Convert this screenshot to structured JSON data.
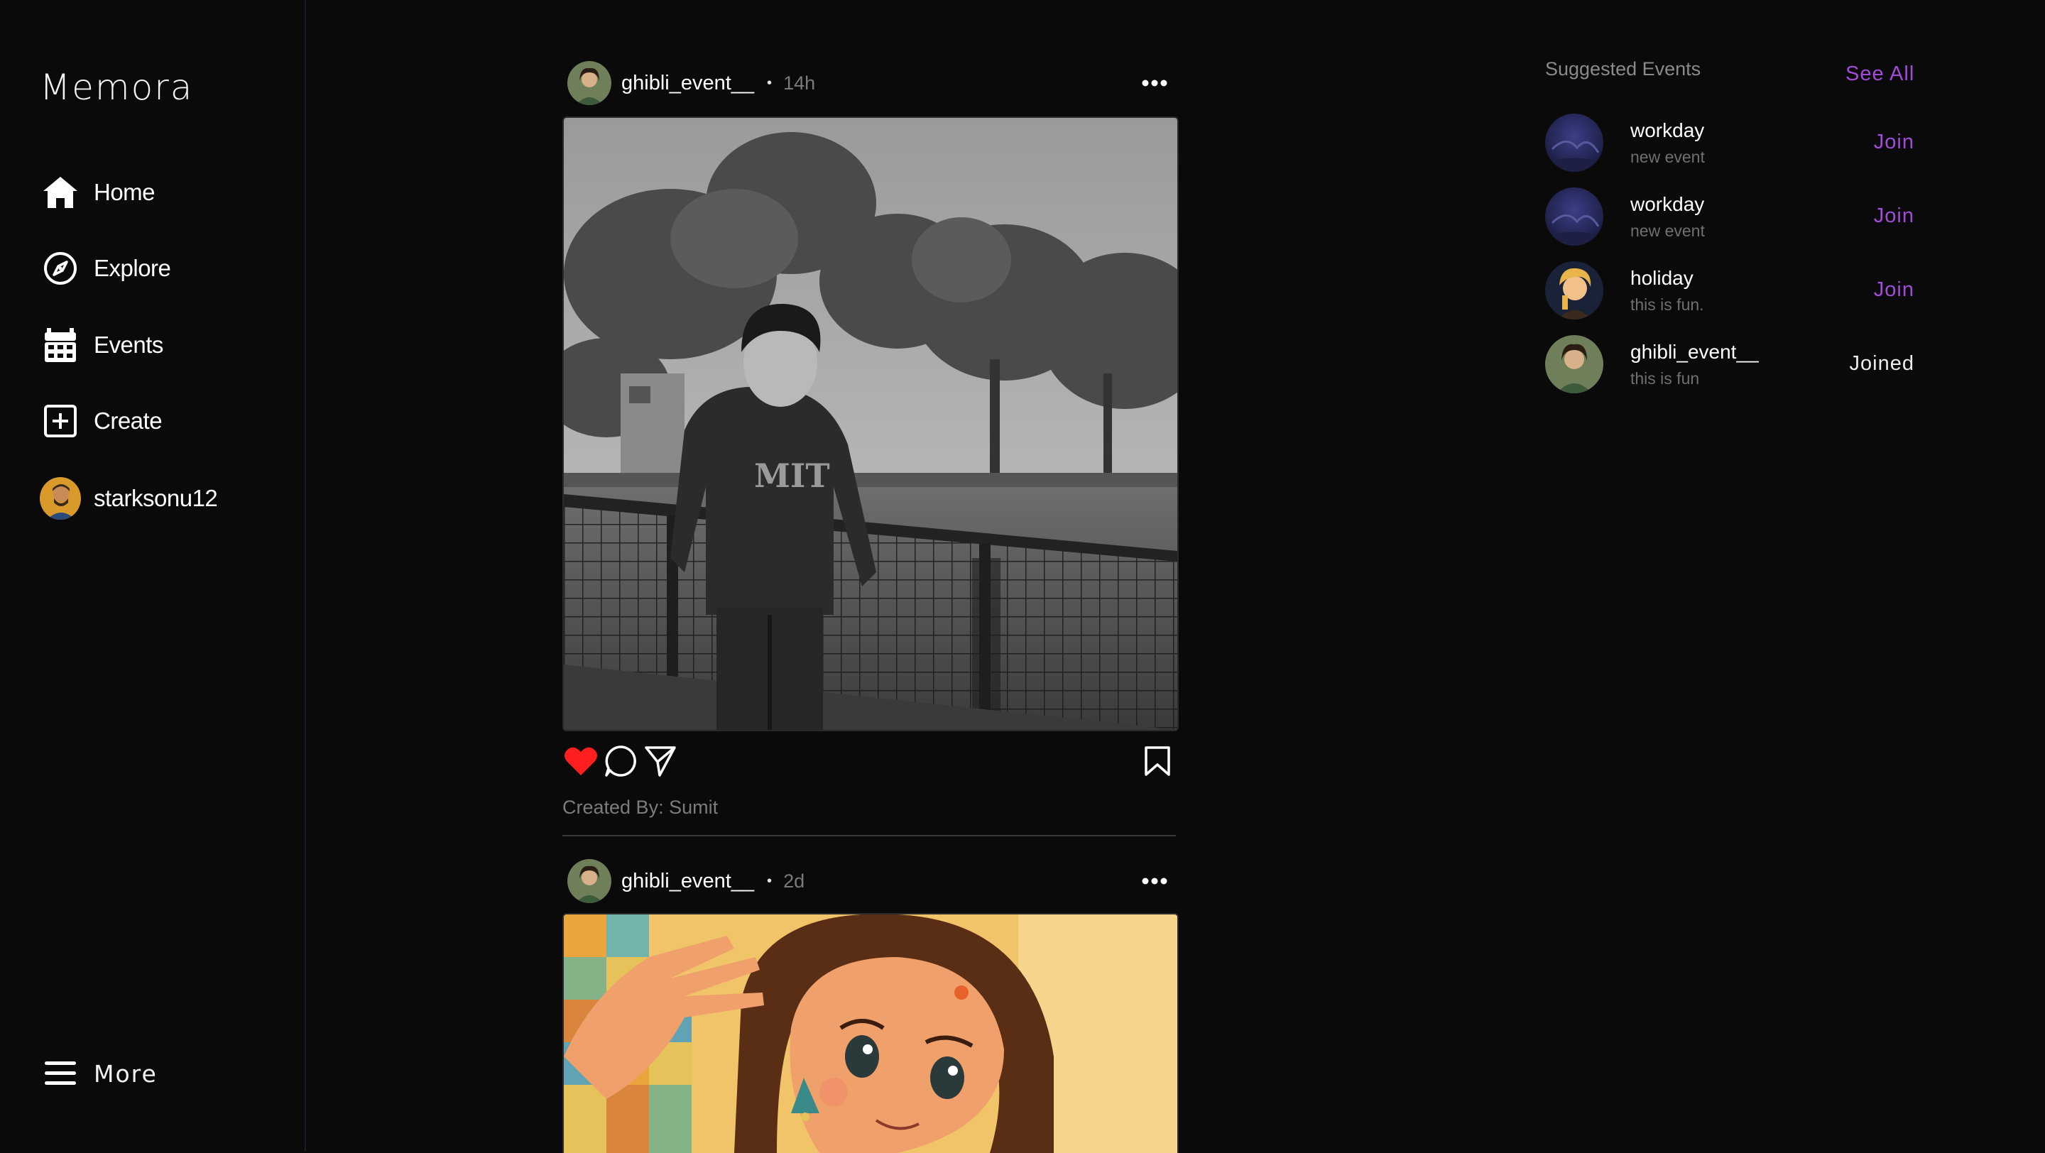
{
  "app": {
    "brand": "Memora"
  },
  "sidebar": {
    "items": [
      {
        "label": "Home",
        "icon": "home-icon"
      },
      {
        "label": "Explore",
        "icon": "compass-icon"
      },
      {
        "label": "Events",
        "icon": "calendar-icon"
      },
      {
        "label": "Create",
        "icon": "plus-square-icon"
      },
      {
        "label": "starksonu12",
        "icon": "avatar"
      }
    ],
    "more_label": "More"
  },
  "feed": {
    "posts": [
      {
        "user": "ghibli_event__",
        "separator": "•",
        "time": "14h",
        "caption": "Created By: Sumit",
        "liked": true
      },
      {
        "user": "ghibli_event__",
        "separator": "•",
        "time": "2d"
      }
    ]
  },
  "suggested": {
    "title": "Suggested Events",
    "see_all": "See All",
    "events": [
      {
        "name": "workday",
        "desc": "new event",
        "action": "Join"
      },
      {
        "name": "workday",
        "desc": "new event",
        "action": "Join"
      },
      {
        "name": "holiday",
        "desc": "this is fun.",
        "action": "Join"
      },
      {
        "name": "ghibli_event__",
        "desc": "this is fun",
        "action": "Joined"
      }
    ]
  },
  "colors": {
    "background": "#0a0a0b",
    "accent": "#a24bd9",
    "like": "#ff1f1f"
  }
}
